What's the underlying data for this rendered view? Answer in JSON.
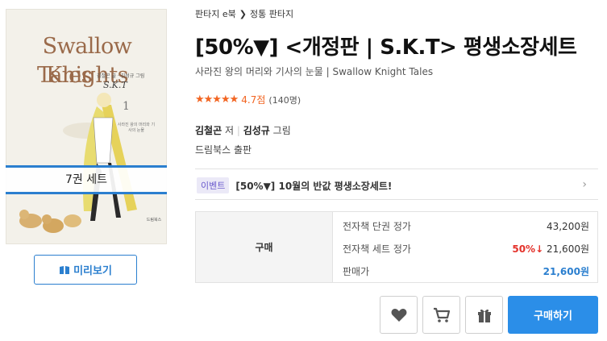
{
  "cover": {
    "title_line1": "Swallow Knights",
    "title_line2": "Tales",
    "authors_small": "김철곤 글 · 김성규 그림",
    "logo": "S.K.T",
    "volume": "1",
    "note": "사라진 왕의 머리와 기사의 눈물",
    "publisher_small": "드림북스",
    "set_label": "7권 세트"
  },
  "preview_button": "미리보기",
  "breadcrumb": [
    "판타지 e북",
    "정통 판타지"
  ],
  "title": "[50%▼] <개정판 | S.K.T> 평생소장세트",
  "subtitle": "사라진 왕의 머리와 기사의 눈물 | Swallow Knight Tales",
  "rating": {
    "stars": "★★★★★",
    "score": "4.7점",
    "count": "(140명)"
  },
  "author": {
    "writer": "김철곤",
    "writer_role": "저",
    "artist": "김성규",
    "artist_role": "그림"
  },
  "publisher": "드림북스 출판",
  "event": {
    "badge": "이벤트",
    "text": "[50%▼] 10월의 반값 평생소장세트!",
    "arrow": "›"
  },
  "price": {
    "buy_label": "구매",
    "rows": [
      {
        "label": "전자책 단권 정가",
        "value": "43,200원"
      },
      {
        "label": "전자책 세트 정가",
        "discount": "50%↓",
        "value": "21,600원"
      },
      {
        "label": "판매가",
        "value": "21,600원"
      }
    ]
  },
  "buttons": {
    "buy": "구매하기",
    "wishlist_icon": "heart-icon",
    "cart_icon": "cart-icon",
    "gift_icon": "gift-icon"
  },
  "colors": {
    "accent": "#2b8ee8",
    "star": "#f26522",
    "discount": "#e4322b"
  }
}
